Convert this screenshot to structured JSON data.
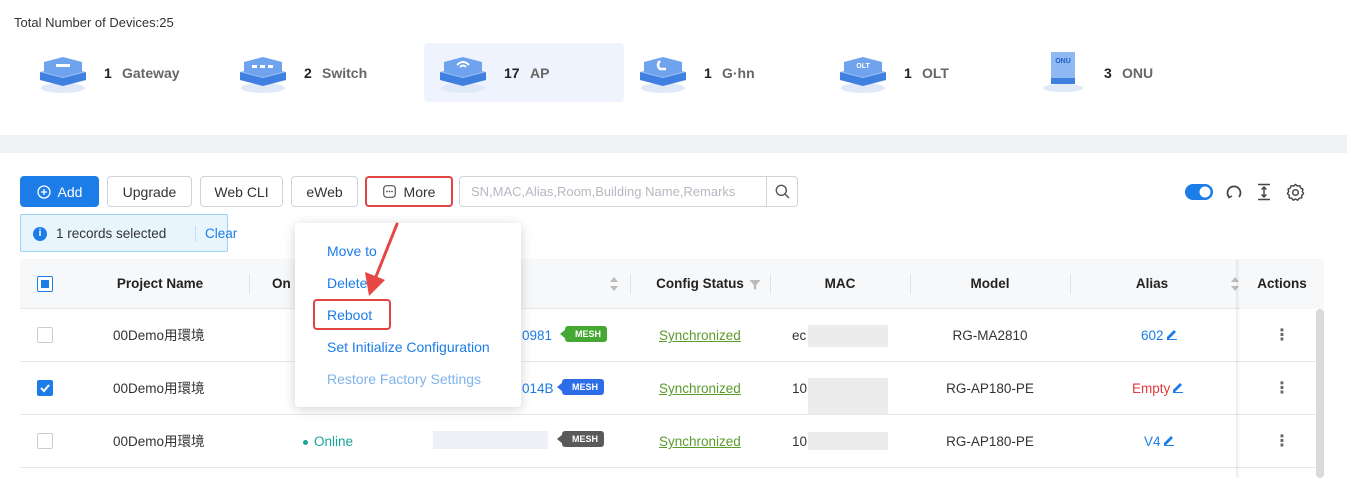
{
  "summary": {
    "title": "Total Number of Devices:25",
    "device_types": [
      {
        "count": "1",
        "label": "Gateway",
        "icon": "gateway-icon",
        "active": false
      },
      {
        "count": "2",
        "label": "Switch",
        "icon": "switch-icon",
        "active": false
      },
      {
        "count": "17",
        "label": "AP",
        "icon": "ap-icon",
        "active": true
      },
      {
        "count": "1",
        "label": "G·hn",
        "icon": "ghn-icon",
        "active": false
      },
      {
        "count": "1",
        "label": "OLT",
        "icon": "olt-icon",
        "active": false
      },
      {
        "count": "3",
        "label": "ONU",
        "icon": "onu-icon",
        "active": false
      }
    ],
    "icon_texts": {
      "olt": "OLT",
      "onu": "ONU"
    }
  },
  "toolbar": {
    "add_label": "Add",
    "upgrade_label": "Upgrade",
    "webcli_label": "Web CLI",
    "eweb_label": "eWeb",
    "more_label": "More",
    "search_placeholder": "SN,MAC,Alias,Room,Building Name,Remarks"
  },
  "selection": {
    "text": "1 records selected",
    "clear_label": "Clear"
  },
  "table": {
    "columns": {
      "project_name": "Project Name",
      "online": "On",
      "config_status": "Config Status",
      "mac": "MAC",
      "model": "Model",
      "alias": "Alias",
      "actions": "Actions"
    },
    "rows": [
      {
        "project": "00Demo用環境",
        "sn_tail": "0981",
        "mesh": "MESH",
        "config": "Synchronized",
        "mac_prefix": "ec",
        "model": "RG-MA2810",
        "alias": "602",
        "checked": false
      },
      {
        "project": "00Demo用環境",
        "sn_tail": "014B",
        "mesh": "MESH",
        "config": "Synchronized",
        "mac_prefix": "10",
        "model": "RG-AP180-PE",
        "alias": "Empty",
        "checked": true
      },
      {
        "project": "00Demo用環境",
        "status": "Online",
        "mesh": "MESH",
        "config": "Synchronized",
        "mac_prefix": "10",
        "model": "RG-AP180-PE",
        "alias": "V4",
        "checked": false
      }
    ]
  },
  "more_menu": {
    "items": [
      {
        "label": "Move to"
      },
      {
        "label": "Delete"
      },
      {
        "label": "Reboot"
      },
      {
        "label": "Set Initialize Configuration"
      },
      {
        "label": "Restore Factory Settings"
      }
    ]
  },
  "colors": {
    "primary": "#1c7ce8",
    "highlight": "#e24444",
    "synchronized": "#5a9b2a",
    "online": "#1aa39a",
    "empty": "#e03b3b"
  }
}
